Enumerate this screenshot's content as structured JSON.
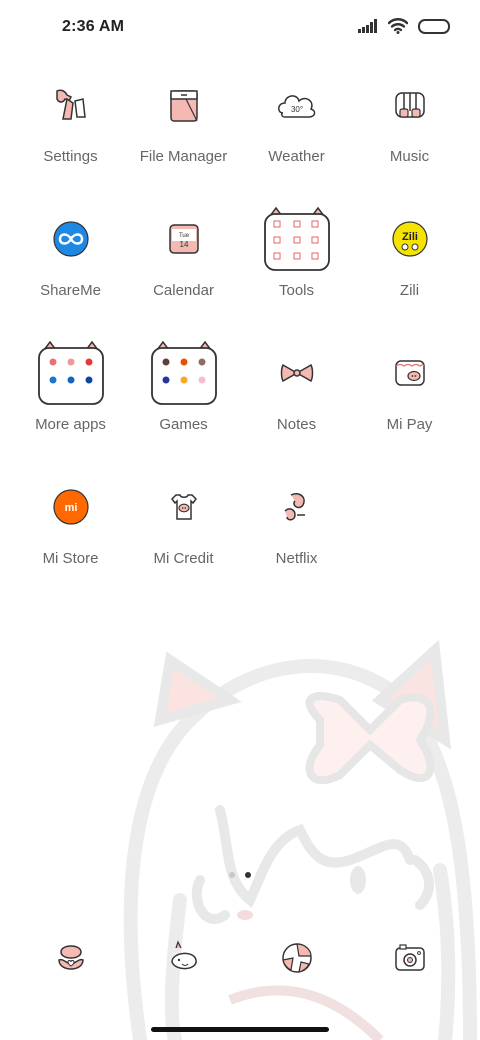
{
  "status_bar": {
    "time": "2:36 AM",
    "icons": [
      "signal-icon",
      "wifi-icon",
      "battery-icon"
    ]
  },
  "apps": [
    {
      "label": "Settings",
      "icon": "settings-icon"
    },
    {
      "label": "File Manager",
      "icon": "file-manager-icon"
    },
    {
      "label": "Weather",
      "icon": "weather-icon",
      "icon_text": "30°"
    },
    {
      "label": "Music",
      "icon": "music-icon"
    },
    {
      "label": "ShareMe",
      "icon": "shareme-icon"
    },
    {
      "label": "Calendar",
      "icon": "calendar-icon",
      "icon_text_day": "Tue",
      "icon_text_date": "14"
    },
    {
      "label": "Tools",
      "icon": "tools-folder-icon"
    },
    {
      "label": "Zili",
      "icon": "zili-icon",
      "icon_text": "Zili"
    },
    {
      "label": "More apps",
      "icon": "more-apps-folder-icon"
    },
    {
      "label": "Games",
      "icon": "games-folder-icon"
    },
    {
      "label": "Notes",
      "icon": "notes-icon"
    },
    {
      "label": "Mi Pay",
      "icon": "mi-pay-icon"
    },
    {
      "label": "Mi Store",
      "icon": "mi-store-icon",
      "icon_text": "mi"
    },
    {
      "label": "Mi Credit",
      "icon": "mi-credit-icon"
    },
    {
      "label": "Netflix",
      "icon": "netflix-icon"
    }
  ],
  "page_indicator": {
    "pages": 2,
    "active": 2
  },
  "dock": [
    {
      "icon": "phone-icon"
    },
    {
      "icon": "messages-icon"
    },
    {
      "icon": "browser-icon"
    },
    {
      "icon": "camera-icon"
    }
  ],
  "colors": {
    "accent_pink": "#f4b9b2",
    "outline": "#333333",
    "shareme_blue": "#1e88e5",
    "zili_yellow": "#f5e400",
    "mi_orange": "#ff6900"
  }
}
